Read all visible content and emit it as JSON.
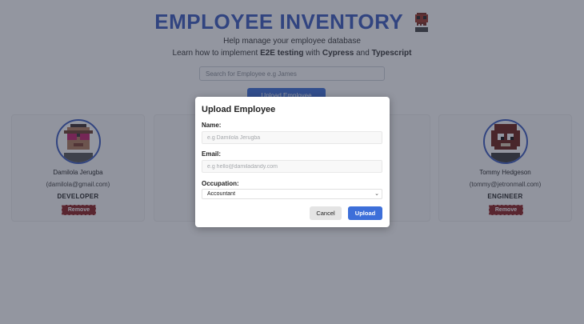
{
  "header": {
    "title": "EMPLOYEE INVENTORY",
    "logo_icon": "pixel-skull-icon",
    "subtitle": "Help manage your employee database",
    "learn": {
      "prefix": "Learn how to implement ",
      "e2e": "E2E testing",
      "with": " with ",
      "cypress": "Cypress",
      "and": " and ",
      "typescript": "Typescript"
    }
  },
  "search": {
    "placeholder": "Search for Employee e.g James",
    "value": ""
  },
  "upload_button": {
    "label": "Upload Employee"
  },
  "employees": [
    {
      "name": "Damilola Jerugba",
      "email": "(damilola@gmail.com)",
      "occupation": "DEVELOPER",
      "remove_label": "Remove",
      "avatar_icon": "pixel-avatar-glasses-icon"
    },
    {
      "name": "Tommy Hedgeson",
      "email": "(tommy@jetronmall.com)",
      "occupation": "ENGINEER",
      "remove_label": "Remove",
      "avatar_icon": "pixel-avatar-dark-icon"
    }
  ],
  "modal": {
    "title": "Upload Employee",
    "name_label": "Name:",
    "name_placeholder": "e.g Damilola Jerugba",
    "email_label": "Email:",
    "email_placeholder": "e.g hello@damiladandy.com",
    "occupation_label": "Occupation:",
    "occupation_value": "Accountant",
    "cancel_label": "Cancel",
    "upload_label": "Upload"
  },
  "colors": {
    "brand": "#3b5bbf",
    "button": "#3d6fd9",
    "remove": "#8b1f1f"
  }
}
